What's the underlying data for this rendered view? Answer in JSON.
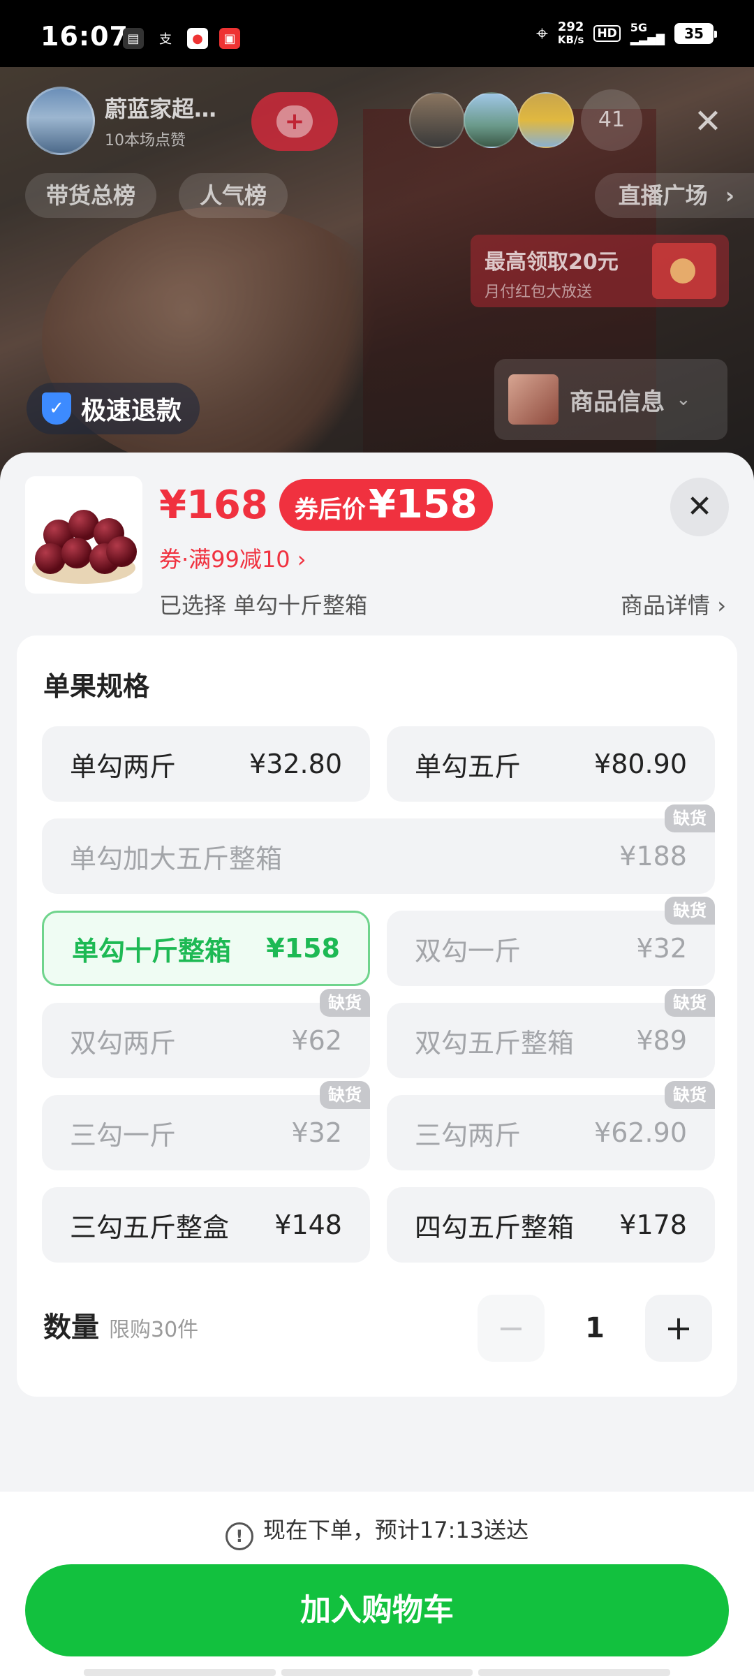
{
  "status_bar": {
    "time": "16:07",
    "net_speed": "292",
    "net_unit": "KB/s",
    "hd": "HD",
    "signal": "5G",
    "battery": "35"
  },
  "live": {
    "host_name": "蔚蓝家超…",
    "host_likes": "10本场点赞",
    "viewer_count": "41",
    "chips": [
      "带货总榜",
      "人气榜"
    ],
    "plaza": "直播广场",
    "promo_title": "最高领取20元",
    "promo_sub": "月付红包大放送",
    "refund": "极速退款",
    "product_info": "商品信息"
  },
  "product": {
    "price": "¥168",
    "coupon_label": "券后价",
    "coupon_price": "¥158",
    "coupon_line": "券·满99减10 ›",
    "selected": "已选择 单勾十斤整箱",
    "detail_link": "商品详情 ›"
  },
  "spec": {
    "title": "单果规格",
    "out_of_stock": "缺货",
    "options": [
      {
        "name": "单勾两斤",
        "price": "¥32.80"
      },
      {
        "name": "单勾五斤",
        "price": "¥80.90"
      },
      {
        "name": "单勾加大五斤整箱",
        "price": "¥188"
      },
      {
        "name": "单勾十斤整箱",
        "price": "¥158"
      },
      {
        "name": "双勾一斤",
        "price": "¥32"
      },
      {
        "name": "双勾两斤",
        "price": "¥62"
      },
      {
        "name": "双勾五斤整箱",
        "price": "¥89"
      },
      {
        "name": "三勾一斤",
        "price": "¥32"
      },
      {
        "name": "三勾两斤",
        "price": "¥62.90"
      },
      {
        "name": "三勾五斤整盒",
        "price": "¥148"
      },
      {
        "name": "四勾五斤整箱",
        "price": "¥178"
      }
    ]
  },
  "quantity": {
    "label": "数量",
    "limit": "限购30件",
    "value": "1",
    "minus": "−",
    "plus": "+"
  },
  "footer": {
    "eta": "现在下单，预计17:13送达",
    "add_to_cart": "加入购物车"
  },
  "colors": {
    "accent_red": "#f0313f",
    "accent_green": "#12c13e"
  }
}
